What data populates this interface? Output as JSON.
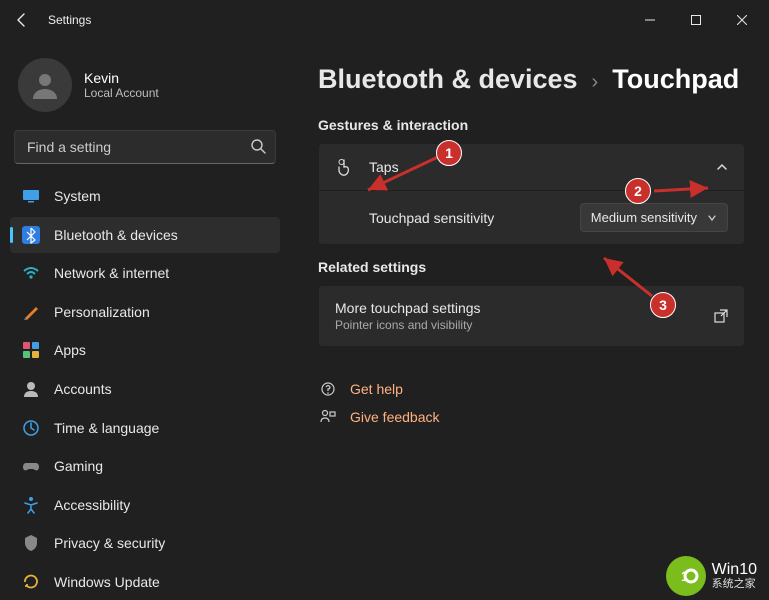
{
  "titlebar": {
    "title": "Settings"
  },
  "profile": {
    "name": "Kevin",
    "sub": "Local Account"
  },
  "search": {
    "placeholder": "Find a setting"
  },
  "nav": {
    "items": [
      {
        "label": "System"
      },
      {
        "label": "Bluetooth & devices"
      },
      {
        "label": "Network & internet"
      },
      {
        "label": "Personalization"
      },
      {
        "label": "Apps"
      },
      {
        "label": "Accounts"
      },
      {
        "label": "Time & language"
      },
      {
        "label": "Gaming"
      },
      {
        "label": "Accessibility"
      },
      {
        "label": "Privacy & security"
      },
      {
        "label": "Windows Update"
      }
    ]
  },
  "breadcrumb": {
    "parent": "Bluetooth & devices",
    "current": "Touchpad"
  },
  "sections": {
    "gestures": "Gestures & interaction",
    "related": "Related settings"
  },
  "taps": {
    "title": "Taps",
    "sensitivity_label": "Touchpad sensitivity",
    "sensitivity_value": "Medium sensitivity"
  },
  "more": {
    "title": "More touchpad settings",
    "sub": "Pointer icons and visibility"
  },
  "links": {
    "help": "Get help",
    "feedback": "Give feedback"
  },
  "annotations": {
    "c1": "1",
    "c2": "2",
    "c3": "3"
  },
  "watermark": {
    "big": "Win10",
    "small": "系统之家"
  }
}
